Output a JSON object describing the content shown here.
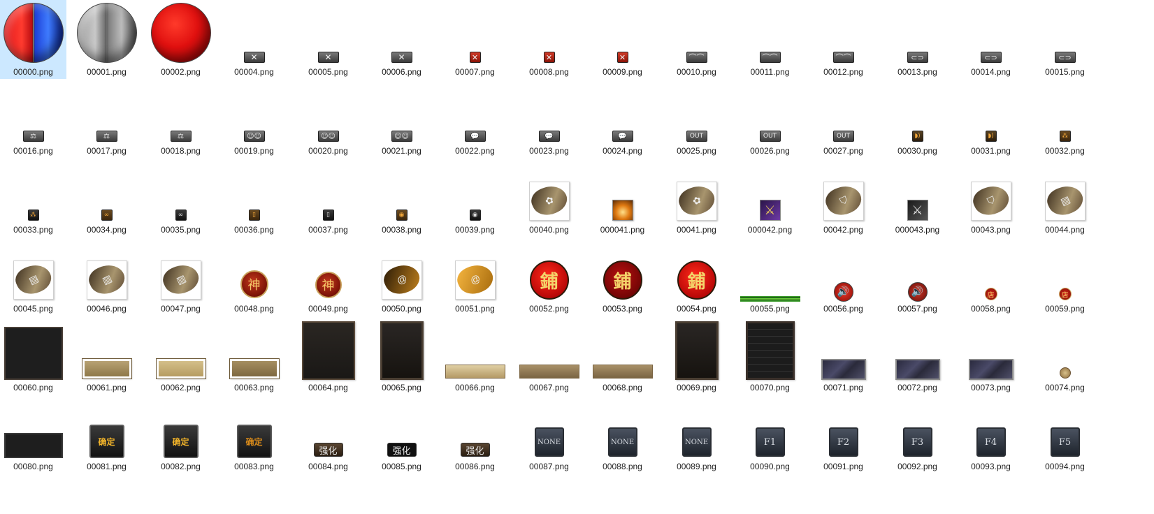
{
  "selected_index": 0,
  "files": [
    {
      "name": "00000.png",
      "icon": "red-blue-orb-icon"
    },
    {
      "name": "00001.png",
      "icon": "grey-orb-icon"
    },
    {
      "name": "00002.png",
      "icon": "red-orb-icon"
    },
    {
      "name": "00004.png",
      "icon": "close-x-icon"
    },
    {
      "name": "00005.png",
      "icon": "close-x-icon"
    },
    {
      "name": "00006.png",
      "icon": "close-x-icon"
    },
    {
      "name": "00007.png",
      "icon": "red-close-x-icon"
    },
    {
      "name": "00008.png",
      "icon": "red-close-x-icon"
    },
    {
      "name": "00009.png",
      "icon": "red-close-x-icon"
    },
    {
      "name": "00010.png",
      "icon": "mountain-icon"
    },
    {
      "name": "00011.png",
      "icon": "mountain-icon"
    },
    {
      "name": "00012.png",
      "icon": "mountain-icon"
    },
    {
      "name": "00013.png",
      "icon": "link-icon"
    },
    {
      "name": "00014.png",
      "icon": "link-icon"
    },
    {
      "name": "00015.png",
      "icon": "link-icon"
    },
    {
      "name": "00016.png",
      "icon": "scale-icon"
    },
    {
      "name": "00017.png",
      "icon": "scale-icon"
    },
    {
      "name": "00018.png",
      "icon": "scale-icon"
    },
    {
      "name": "00019.png",
      "icon": "group-icon"
    },
    {
      "name": "00020.png",
      "icon": "group-icon"
    },
    {
      "name": "00021.png",
      "icon": "group-icon"
    },
    {
      "name": "00022.png",
      "icon": "chat-bubble-icon"
    },
    {
      "name": "00023.png",
      "icon": "chat-bubble-icon"
    },
    {
      "name": "00024.png",
      "icon": "chat-bubble-icon"
    },
    {
      "name": "00025.png",
      "icon": "out-button-icon",
      "text": "OUT"
    },
    {
      "name": "00026.png",
      "icon": "out-button-icon",
      "text": "OUT"
    },
    {
      "name": "00027.png",
      "icon": "out-button-icon",
      "text": "OUT"
    },
    {
      "name": "00030.png",
      "icon": "sound-wave-icon"
    },
    {
      "name": "00031.png",
      "icon": "sound-wave-icon"
    },
    {
      "name": "00032.png",
      "icon": "group-small-icon"
    },
    {
      "name": "00033.png",
      "icon": "group-small-icon"
    },
    {
      "name": "00034.png",
      "icon": "link-small-icon"
    },
    {
      "name": "00035.png",
      "icon": "link-small-icon"
    },
    {
      "name": "00036.png",
      "icon": "book-small-icon"
    },
    {
      "name": "00037.png",
      "icon": "book-small-icon"
    },
    {
      "name": "00038.png",
      "icon": "radio-small-icon"
    },
    {
      "name": "00039.png",
      "icon": "radio-small-icon"
    },
    {
      "name": "00040.png",
      "icon": "bag-tab-icon"
    },
    {
      "name": "000041.png",
      "icon": "flame-item-icon"
    },
    {
      "name": "00041.png",
      "icon": "bag-tab-icon"
    },
    {
      "name": "000042.png",
      "icon": "purple-sword-icon"
    },
    {
      "name": "00042.png",
      "icon": "helmet-tab-icon"
    },
    {
      "name": "000043.png",
      "icon": "silver-sword-icon"
    },
    {
      "name": "00043.png",
      "icon": "helmet-tab-icon"
    },
    {
      "name": "00044.png",
      "icon": "scroll-tab-icon"
    },
    {
      "name": "00045.png",
      "icon": "scroll-tab-icon"
    },
    {
      "name": "00046.png",
      "icon": "book-tab-icon"
    },
    {
      "name": "00047.png",
      "icon": "book-tab-icon"
    },
    {
      "name": "00048.png",
      "icon": "shen-coin-icon",
      "text": "神"
    },
    {
      "name": "00049.png",
      "icon": "shen-coin-icon",
      "text": "神"
    },
    {
      "name": "00050.png",
      "icon": "swirl-tab-icon"
    },
    {
      "name": "00051.png",
      "icon": "swirl-tab-icon"
    },
    {
      "name": "00052.png",
      "icon": "shop-orb-icon",
      "text": "鋪"
    },
    {
      "name": "00053.png",
      "icon": "shop-orb-icon",
      "text": "鋪"
    },
    {
      "name": "00054.png",
      "icon": "shop-orb-icon",
      "text": "鋪"
    },
    {
      "name": "00055.png",
      "icon": "green-bar-icon"
    },
    {
      "name": "00056.png",
      "icon": "speaker-icon"
    },
    {
      "name": "00057.png",
      "icon": "speaker-icon"
    },
    {
      "name": "00058.png",
      "icon": "shop-small-icon",
      "text": "店"
    },
    {
      "name": "00059.png",
      "icon": "shop-small-icon",
      "text": "店"
    },
    {
      "name": "00060.png",
      "icon": "panel-window-icon"
    },
    {
      "name": "00061.png",
      "icon": "gold-bar-icon"
    },
    {
      "name": "00062.png",
      "icon": "gold-bar-icon"
    },
    {
      "name": "00063.png",
      "icon": "gold-bar-icon"
    },
    {
      "name": "00064.png",
      "icon": "form-window-icon"
    },
    {
      "name": "00065.png",
      "icon": "tall-window-icon"
    },
    {
      "name": "00066.png",
      "icon": "tan-strip-icon"
    },
    {
      "name": "00067.png",
      "icon": "tan-strip-icon"
    },
    {
      "name": "00068.png",
      "icon": "tan-strip-icon"
    },
    {
      "name": "00069.png",
      "icon": "tall-window-icon"
    },
    {
      "name": "00070.png",
      "icon": "inventory-grid-icon"
    },
    {
      "name": "00071.png",
      "icon": "marble-slot-icon"
    },
    {
      "name": "00072.png",
      "icon": "marble-slot-icon"
    },
    {
      "name": "00073.png",
      "icon": "marble-slot-icon"
    },
    {
      "name": "00074.png",
      "icon": "small-emblem-icon"
    },
    {
      "name": "00080.png",
      "icon": "dark-panel-icon"
    },
    {
      "name": "00081.png",
      "icon": "confirm-button-icon",
      "text": "确定"
    },
    {
      "name": "00082.png",
      "icon": "confirm-button-icon",
      "text": "确定"
    },
    {
      "name": "00083.png",
      "icon": "confirm-button-icon",
      "text": "确定"
    },
    {
      "name": "00084.png",
      "icon": "enhance-button-icon",
      "text": "强化"
    },
    {
      "name": "00085.png",
      "icon": "enhance-button-icon",
      "text": "强化"
    },
    {
      "name": "00086.png",
      "icon": "enhance-button-icon",
      "text": "强化"
    },
    {
      "name": "00087.png",
      "icon": "key-button-icon",
      "text": "NONE"
    },
    {
      "name": "00088.png",
      "icon": "key-button-icon",
      "text": "NONE"
    },
    {
      "name": "00089.png",
      "icon": "key-button-icon",
      "text": "NONE"
    },
    {
      "name": "00090.png",
      "icon": "key-button-icon",
      "text": "F1"
    },
    {
      "name": "00091.png",
      "icon": "key-button-icon",
      "text": "F2"
    },
    {
      "name": "00092.png",
      "icon": "key-button-icon",
      "text": "F3"
    },
    {
      "name": "00093.png",
      "icon": "key-button-icon",
      "text": "F4"
    },
    {
      "name": "00094.png",
      "icon": "key-button-icon",
      "text": "F5"
    }
  ]
}
